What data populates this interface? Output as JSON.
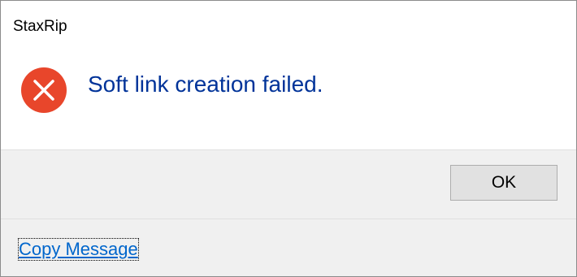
{
  "window": {
    "title": "StaxRip"
  },
  "content": {
    "icon": "error-icon",
    "message": "Soft link creation failed."
  },
  "buttons": {
    "ok_label": "OK"
  },
  "footer": {
    "copy_message_label": "Copy Message"
  },
  "colors": {
    "message_text": "#003399",
    "error_icon": "#e8462b",
    "link": "#0066cc",
    "button_face": "#e1e1e1",
    "panel_bg": "#f0f0f0"
  }
}
